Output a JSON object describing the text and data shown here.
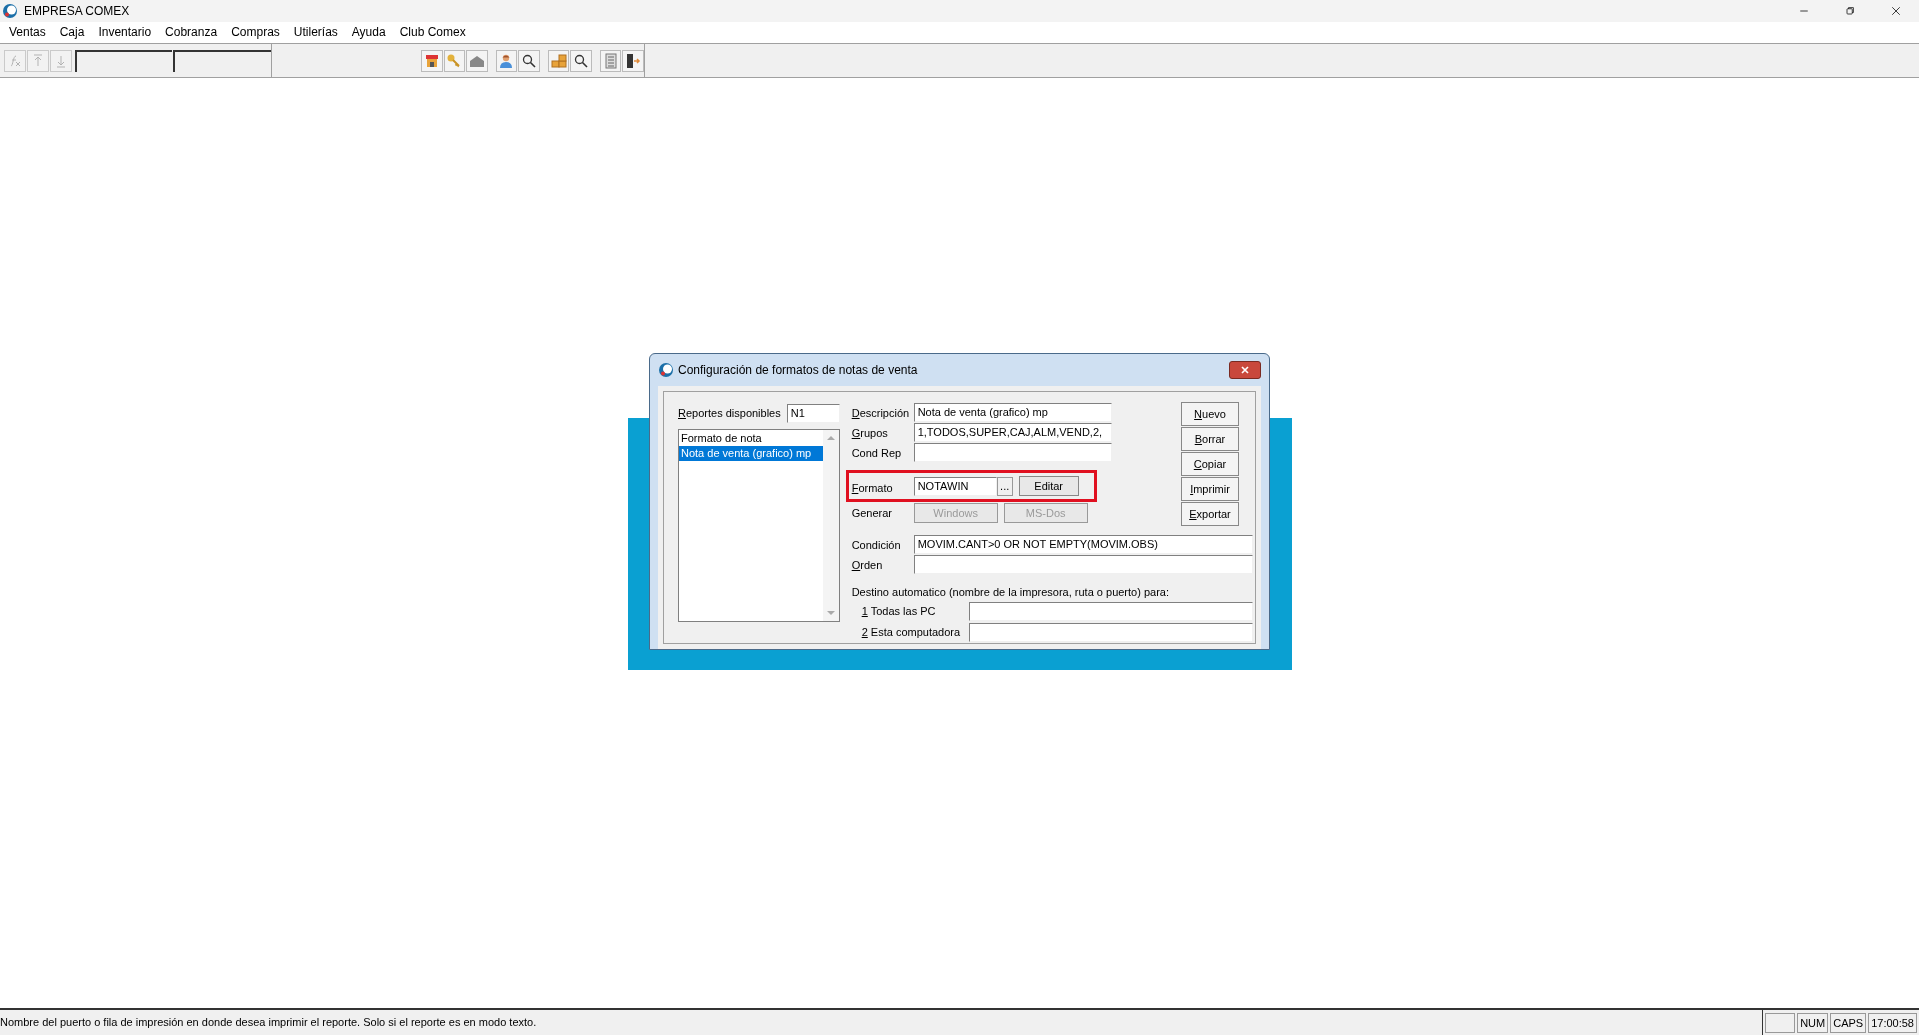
{
  "window": {
    "title": "EMPRESA COMEX"
  },
  "menu": [
    "Ventas",
    "Caja",
    "Inventario",
    "Cobranza",
    "Compras",
    "Utilerías",
    "Ayuda",
    "Club Comex"
  ],
  "toolbar": {
    "buttons": [
      {
        "kind": "formula",
        "disabled": true
      },
      {
        "kind": "up",
        "disabled": true
      },
      {
        "kind": "down",
        "disabled": true
      },
      {
        "kind": "store",
        "disabled": false
      },
      {
        "kind": "key",
        "disabled": false
      },
      {
        "kind": "house",
        "disabled": false
      },
      {
        "kind": "person",
        "disabled": false
      },
      {
        "kind": "search",
        "disabled": false
      },
      {
        "kind": "boxes",
        "disabled": false
      },
      {
        "kind": "search",
        "disabled": false
      },
      {
        "kind": "list",
        "disabled": false
      },
      {
        "kind": "exit",
        "disabled": false
      }
    ]
  },
  "dialog": {
    "title": "Configuración de formatos de notas de venta",
    "reports_label": {
      "text": "Reportes disponibles",
      "accel": true
    },
    "report_code": "N1",
    "reports": [
      {
        "label": "Formato de nota",
        "selected": false
      },
      {
        "label": "Nota de venta (grafico) mp",
        "selected": true
      }
    ],
    "top_fields": [
      {
        "label": "Descripción",
        "accel": true,
        "value": "Nota de venta (grafico) mp"
      },
      {
        "label": "Grupos",
        "accel": true,
        "value": "1,TODOS,SUPER,CAJ,ALM,VEND,2,"
      },
      {
        "label": "Cond Rep",
        "accel": false
      }
    ],
    "formato": {
      "label": "Formato",
      "accel": true,
      "value": "NOTAWIN",
      "browse": "...",
      "edit": "Editar",
      "highlighted": true
    },
    "generar": {
      "label": "Generar",
      "buttons": [
        {
          "label": "Windows",
          "disabled": true
        },
        {
          "label": "MS-Dos",
          "disabled": true
        }
      ]
    },
    "bottom_fields": [
      {
        "label": "Condición",
        "accel": false,
        "value": "MOVIM.CANT>0 OR NOT EMPTY(MOVIM.OBS)"
      },
      {
        "label": "Orden",
        "accel": true
      }
    ],
    "destination_note": "Destino automatico (nombre de la impresora, ruta o puerto) para:",
    "destinations": [
      {
        "label": "1 Todas las PC",
        "accel": true
      },
      {
        "label": "2 Esta computadora",
        "accel": true
      }
    ],
    "side_buttons": [
      {
        "label": "Nuevo",
        "accel": true
      },
      {
        "label": "Borrar",
        "accel": true
      },
      {
        "label": "Copiar",
        "accel": true
      },
      {
        "label": "Imprimir",
        "accel": true
      },
      {
        "label": "Exportar",
        "accel": true
      }
    ]
  },
  "status_bar": {
    "message": "Nombre del puerto o fila de impresión en donde desea imprimir el reporte. Solo si el reporte es en modo texto.",
    "indicators": [
      "NUM",
      "CAPS",
      "17:00:58"
    ]
  }
}
